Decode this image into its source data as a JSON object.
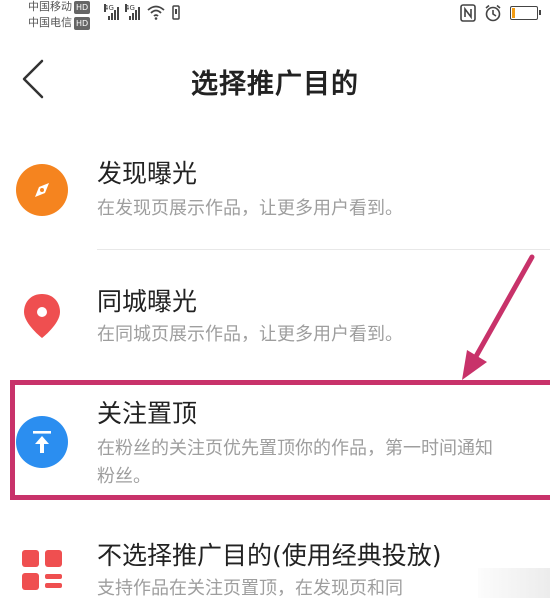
{
  "statusbar": {
    "carrier1": "中国移动",
    "carrier2": "中国电信",
    "hd_badge": "HD",
    "network": "4G"
  },
  "header": {
    "title": "选择推广目的",
    "back_icon": "chevron-left-icon"
  },
  "options": [
    {
      "title": "发现曝光",
      "desc": "在发现页展示作品，让更多用户看到。",
      "icon": "compass-icon",
      "color": "#f5841f"
    },
    {
      "title": "同城曝光",
      "desc": "在同城页展示作品，让更多用户看到。",
      "icon": "location-pin-icon",
      "color": "#ef4f50"
    },
    {
      "title": "关注置顶",
      "desc_line1": "在粉丝的关注页优先置顶你的作品，第一时间通知",
      "desc_line2": "粉丝。",
      "icon": "pin-to-top-icon",
      "color": "#2b8ef0"
    },
    {
      "title": "不选择推广目的(使用经典投放)",
      "desc": "支持作品在关注页置顶，在发现页和同",
      "icon": "grid-icon",
      "color": "#ef4f50"
    }
  ],
  "annotation": {
    "highlight_color": "#c8326a"
  }
}
